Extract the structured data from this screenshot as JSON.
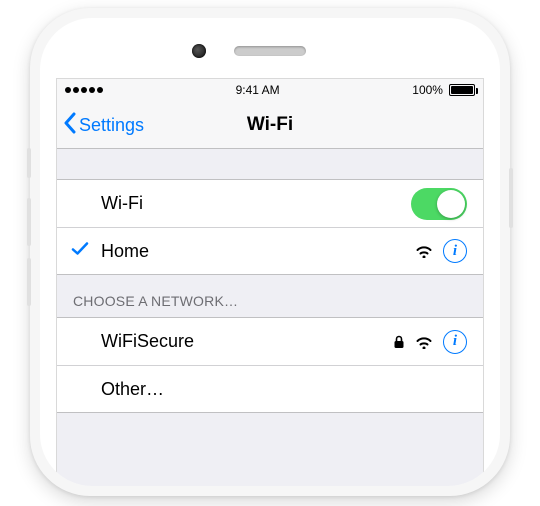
{
  "status": {
    "time": "9:41 AM",
    "battery_pct": "100%"
  },
  "nav": {
    "back_label": "Settings",
    "title": "Wi-Fi"
  },
  "wifi_toggle": {
    "label": "Wi-Fi",
    "on": true
  },
  "connected": {
    "name": "Home"
  },
  "choose_header": "CHOOSE A NETWORK…",
  "networks": [
    {
      "name": "WiFiSecure",
      "secured": true
    }
  ],
  "other_label": "Other…"
}
